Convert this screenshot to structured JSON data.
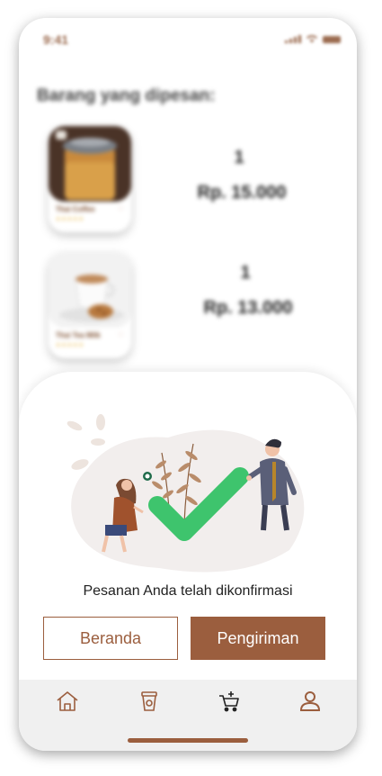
{
  "status": {
    "time": "9:41"
  },
  "heading": "Barang yang dipesan:",
  "items": [
    {
      "name": "Thai Coffee",
      "stars": "★★★★★",
      "quantity": "1",
      "price": "Rp. 15.000"
    },
    {
      "name": "Thai Tea Milk",
      "stars": "★★★★★",
      "quantity": "1",
      "price": "Rp. 13.000"
    }
  ],
  "confirmation": {
    "message": "Pesanan Anda telah dikonfirmasi",
    "home_button": "Beranda",
    "shipping_button": "Pengiriman"
  },
  "nav": {
    "icons": [
      "home-icon",
      "coffee-cup-icon",
      "cart-icon",
      "profile-icon"
    ]
  },
  "colors": {
    "accent": "#9b5e3e",
    "check": "#3ec46d",
    "nav_bg": "#f0f0f0"
  }
}
